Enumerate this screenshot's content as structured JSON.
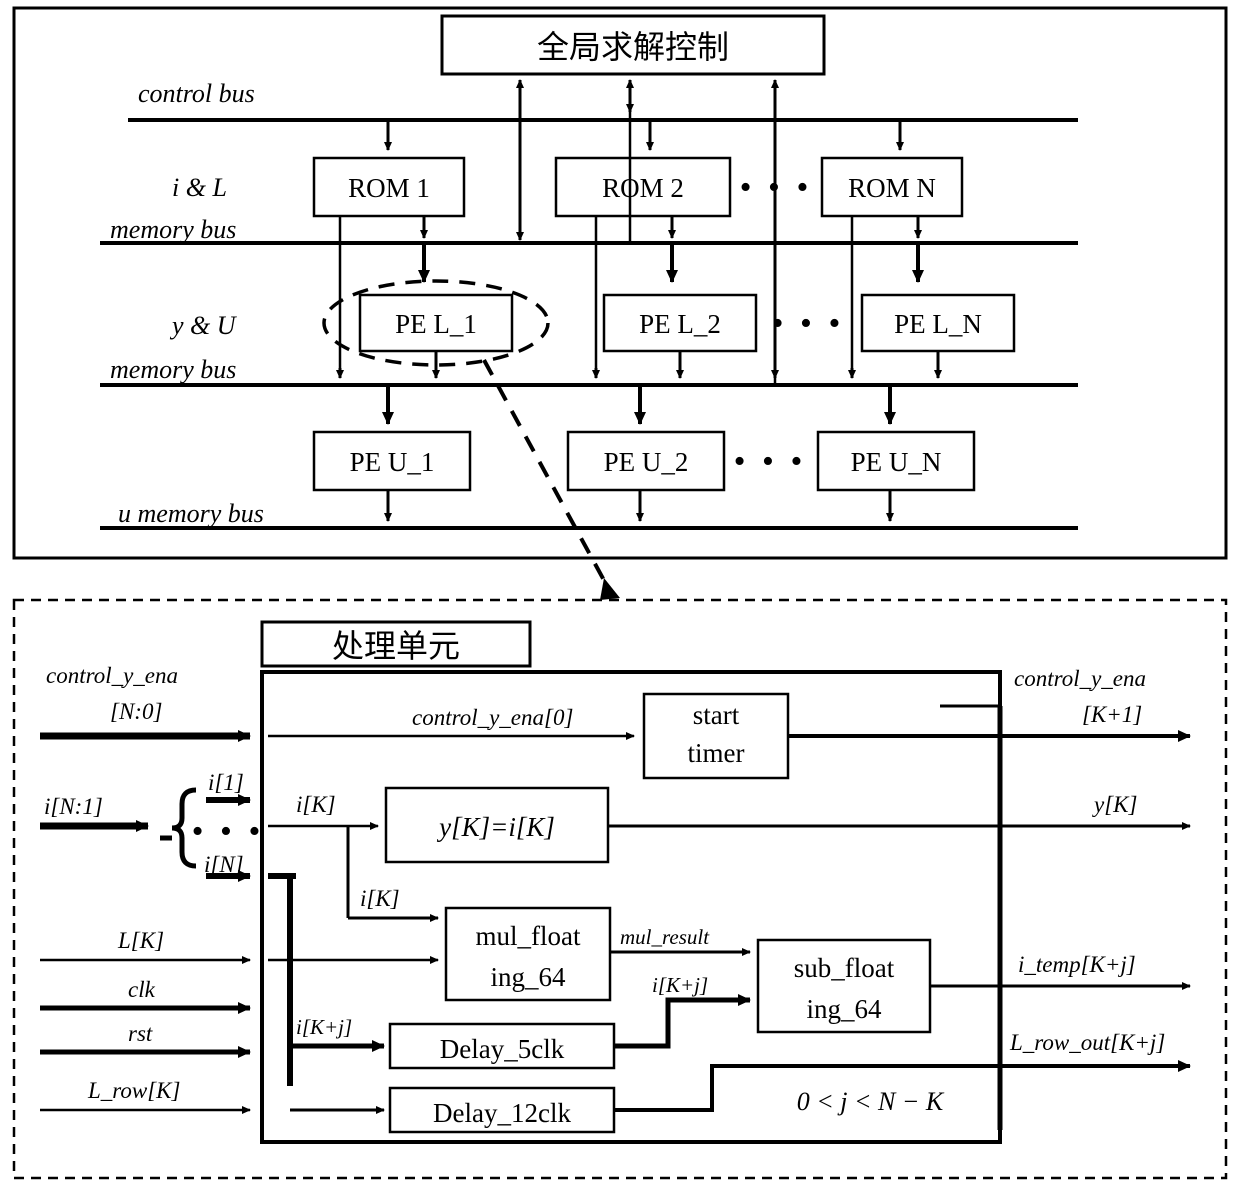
{
  "figure": {
    "domain": "diagram",
    "stroke_color": "#000000",
    "background": "#ffffff"
  },
  "top_panel": {
    "name": "architecture-overview",
    "global_control_box": "全局求解控制",
    "bus_labels": [
      {
        "id": "control-bus",
        "text": "control bus"
      },
      {
        "id": "i-l-memory-bus",
        "line1": "i & L",
        "line2": "memory bus"
      },
      {
        "id": "y-u-memory-bus",
        "line1": "y & U",
        "line2": "memory bus"
      },
      {
        "id": "u-memory-bus",
        "text": "u memory bus"
      }
    ],
    "rom_row": {
      "boxes": [
        "ROM 1",
        "ROM 2",
        "ROM N"
      ],
      "ellipsis": "• • •"
    },
    "pe_l_row": {
      "boxes": [
        "PE L_1",
        "PE L_2",
        "PE L_N"
      ],
      "ellipsis": "• • •",
      "highlighted": "PE L_1"
    },
    "pe_u_row": {
      "boxes": [
        "PE U_1",
        "PE U_2",
        "PE U_N"
      ],
      "ellipsis": "• • •"
    }
  },
  "bottom_panel": {
    "name": "processing-element-detail",
    "title": "处理单元",
    "condition": "0 < j < N − K",
    "inputs": [
      {
        "id": "control-y-ena-in",
        "line1": "control_y_ena",
        "line2": "[N:0]"
      },
      {
        "id": "i-bus-in",
        "text": "i[N:1]"
      },
      {
        "id": "i-1",
        "text": "i[1]"
      },
      {
        "id": "i-n",
        "text": "i[N]"
      },
      {
        "id": "i-dots",
        "text": "• • •"
      },
      {
        "id": "l-k",
        "text": "L[K]"
      },
      {
        "id": "clk",
        "text": "clk"
      },
      {
        "id": "rst",
        "text": "rst"
      },
      {
        "id": "l-row-k",
        "text": "L_row[K]"
      }
    ],
    "internal_signals": [
      {
        "id": "control-y-ena-0",
        "text": "control_y_ena[0]"
      },
      {
        "id": "i-k-to-y",
        "text": "i[K]"
      },
      {
        "id": "i-k-to-mul",
        "text": "i[K]"
      },
      {
        "id": "mul-result",
        "text": "mul_result"
      },
      {
        "id": "i-k-plus-j-to-sub",
        "text": "i[K+j]"
      },
      {
        "id": "i-k-plus-j-to-delay",
        "text": "i[K+j]"
      }
    ],
    "blocks": [
      {
        "id": "start-timer",
        "line1": "start",
        "line2": "timer"
      },
      {
        "id": "y-assign",
        "line1": "y[K]=i[K]",
        "line2": ""
      },
      {
        "id": "mul-floating-64",
        "line1": "mul_float",
        "line2": "ing_64"
      },
      {
        "id": "sub-floating-64",
        "line1": "sub_float",
        "line2": "ing_64"
      },
      {
        "id": "delay-5clk",
        "line1": "Delay_5clk",
        "line2": ""
      },
      {
        "id": "delay-12clk",
        "line1": "Delay_12clk",
        "line2": ""
      }
    ],
    "outputs": [
      {
        "id": "control-y-ena-out",
        "line1": "control_y_ena",
        "line2": "[K+1]"
      },
      {
        "id": "y-k-out",
        "text": "y[K]"
      },
      {
        "id": "i-temp-out",
        "text": "i_temp[K+j]"
      },
      {
        "id": "l-row-out",
        "text": "L_row_out[K+j]"
      }
    ]
  }
}
